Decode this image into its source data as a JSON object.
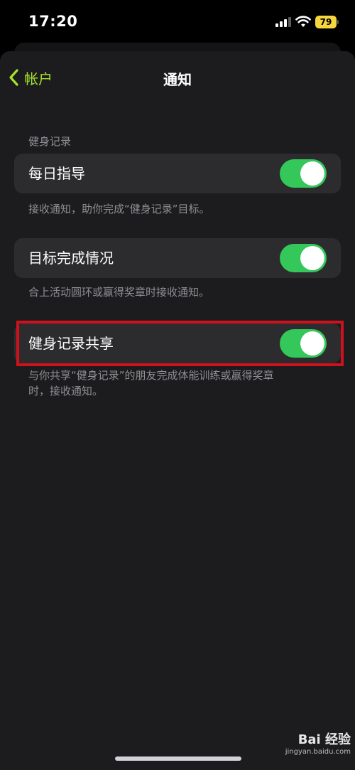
{
  "status_bar": {
    "time": "17:20",
    "battery_level": "79",
    "battery_color": "#f5d63d",
    "icons": [
      "cellular-signal-icon",
      "wifi-icon",
      "battery-icon"
    ]
  },
  "nav": {
    "back_label": "帐户",
    "title": "通知",
    "accent_color": "#a6e22e"
  },
  "section": {
    "header": "健身记录",
    "items": [
      {
        "label": "每日指导",
        "enabled": true,
        "footnote": "接收通知，助你完成“健身记录”目标。"
      },
      {
        "label": "目标完成情况",
        "enabled": true,
        "footnote": "合上活动圆环或赢得奖章时接收通知。"
      },
      {
        "label": "健身记录共享",
        "enabled": true,
        "footnote_line1": "与你共享“健身记录”的朋友完成体能训练或赢得奖章",
        "footnote_line2": "时，接收通知。",
        "highlighted": true
      }
    ],
    "toggle_on_color": "#34c759",
    "highlight_color": "#d0111b"
  },
  "watermark": {
    "logo": "Bai 经验",
    "url": "jingyan.baidu.com"
  }
}
